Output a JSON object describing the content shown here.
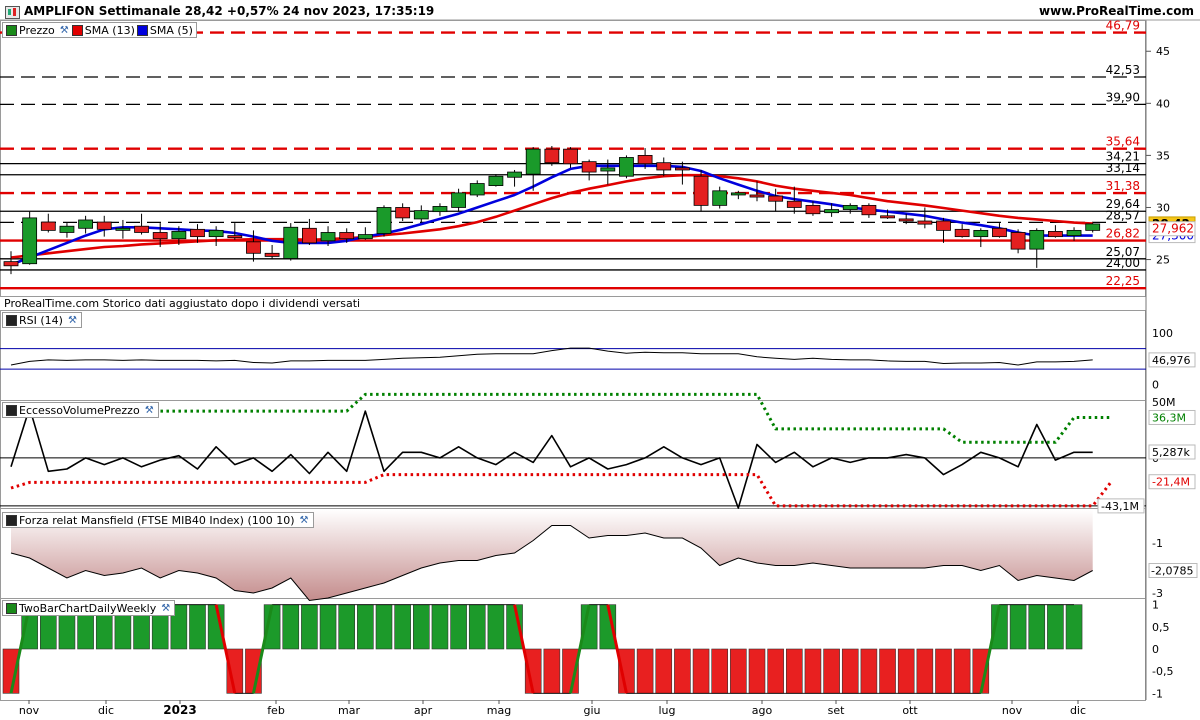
{
  "header": {
    "title": "AMPLIFON Settimanale 28,42 +0,57% 24 nov 2023, 17:35:19",
    "site": "www.ProRealTime.com",
    "source_note": "ProRealTime.com  Storico dati aggiustato dopo i dividendi versati"
  },
  "panels": {
    "price": {
      "legend": [
        {
          "label": "Prezzo",
          "color": "#1a8a1a"
        },
        {
          "label": "SMA (13)",
          "color": "#e00000"
        },
        {
          "label": "SMA (5)",
          "color": "#0000dd"
        }
      ]
    },
    "rsi": {
      "label": "RSI (14)"
    },
    "volume": {
      "label": "EccessoVolumePrezzo"
    },
    "mansfield": {
      "label": "Forza relat Mansfield (FTSE MIB40 Index) (100 10)"
    },
    "twobar": {
      "label": "TwoBarChartDailyWeekly"
    }
  },
  "chart_data": [
    {
      "type": "candlestick",
      "panel": "price",
      "title": "AMPLIFON Settimanale",
      "x_labels": [
        "nov",
        "dic",
        "2023",
        "feb",
        "mar",
        "apr",
        "mag",
        "giu",
        "lug",
        "ago",
        "set",
        "ott",
        "nov",
        "dic"
      ],
      "y_ticks": [
        25,
        30,
        35,
        40,
        45
      ],
      "ylim": [
        21.5,
        48
      ],
      "ohlc": [
        [
          24.8,
          25.8,
          23.6,
          24.4
        ],
        [
          24.6,
          29.6,
          24.5,
          29.0
        ],
        [
          28.6,
          29.4,
          27.6,
          27.8
        ],
        [
          27.6,
          28.5,
          27.1,
          28.2
        ],
        [
          28.0,
          29.2,
          27.5,
          28.8
        ],
        [
          28.6,
          29.2,
          27.2,
          27.9
        ],
        [
          27.8,
          28.8,
          27.0,
          28.0
        ],
        [
          28.2,
          29.4,
          27.4,
          27.6
        ],
        [
          27.6,
          28.5,
          26.2,
          27.0
        ],
        [
          27.0,
          28.2,
          26.4,
          27.7
        ],
        [
          27.9,
          28.4,
          26.6,
          27.2
        ],
        [
          27.2,
          28.2,
          26.3,
          27.8
        ],
        [
          27.3,
          28.5,
          26.9,
          27.1
        ],
        [
          26.7,
          27.8,
          24.8,
          25.6
        ],
        [
          25.6,
          26.4,
          25.0,
          25.3
        ],
        [
          25.1,
          28.5,
          24.9,
          28.1
        ],
        [
          28.0,
          28.9,
          26.4,
          26.6
        ],
        [
          26.8,
          28.2,
          26.3,
          27.6
        ],
        [
          27.6,
          28.0,
          26.6,
          27.0
        ],
        [
          27.0,
          28.1,
          26.9,
          27.4
        ],
        [
          27.5,
          30.2,
          27.2,
          30.0
        ],
        [
          30.0,
          30.4,
          28.7,
          29.0
        ],
        [
          28.9,
          30.2,
          28.6,
          29.7
        ],
        [
          29.6,
          30.4,
          29.2,
          30.1
        ],
        [
          30.0,
          31.8,
          29.6,
          31.4
        ],
        [
          31.2,
          32.6,
          31.0,
          32.3
        ],
        [
          32.1,
          33.2,
          32.0,
          33.0
        ],
        [
          32.9,
          33.6,
          32.0,
          33.4
        ],
        [
          33.2,
          35.8,
          31.6,
          35.6
        ],
        [
          35.6,
          35.9,
          34.0,
          34.3
        ],
        [
          35.6,
          35.8,
          33.8,
          34.2
        ],
        [
          34.4,
          34.6,
          32.6,
          33.4
        ],
        [
          33.5,
          34.6,
          32.2,
          33.8
        ],
        [
          33.0,
          35.0,
          32.8,
          34.8
        ],
        [
          35.0,
          35.7,
          33.7,
          34.2
        ],
        [
          34.3,
          34.8,
          33.0,
          33.6
        ],
        [
          33.8,
          34.4,
          32.2,
          33.6
        ],
        [
          33.0,
          33.6,
          29.6,
          30.2
        ],
        [
          30.2,
          32.0,
          29.9,
          31.6
        ],
        [
          31.2,
          31.6,
          30.8,
          31.4
        ],
        [
          31.2,
          32.5,
          30.6,
          31.0
        ],
        [
          31.1,
          31.8,
          29.6,
          30.6
        ],
        [
          30.6,
          32.0,
          29.4,
          30.0
        ],
        [
          30.2,
          30.6,
          29.2,
          29.4
        ],
        [
          29.5,
          30.4,
          29.1,
          29.8
        ],
        [
          29.8,
          30.4,
          29.4,
          30.2
        ],
        [
          30.2,
          30.4,
          29.0,
          29.3
        ],
        [
          29.2,
          29.8,
          28.9,
          29.0
        ],
        [
          28.9,
          29.4,
          28.4,
          28.7
        ],
        [
          28.7,
          30.0,
          28.0,
          28.4
        ],
        [
          28.7,
          29.0,
          26.6,
          27.8
        ],
        [
          27.9,
          28.4,
          27.1,
          27.2
        ],
        [
          27.2,
          28.0,
          26.2,
          27.8
        ],
        [
          28.0,
          28.5,
          27.1,
          27.2
        ],
        [
          27.6,
          27.9,
          25.6,
          26.0
        ],
        [
          26.0,
          28.0,
          24.2,
          27.8
        ],
        [
          27.7,
          28.3,
          27.1,
          27.2
        ],
        [
          27.3,
          28.1,
          26.8,
          27.8
        ],
        [
          27.8,
          28.5,
          27.6,
          28.42
        ]
      ],
      "series": [
        {
          "name": "SMA (13)",
          "color": "#e00000",
          "values": [
            25.2,
            25.4,
            25.6,
            25.8,
            26.0,
            26.2,
            26.3,
            26.45,
            26.55,
            26.65,
            26.75,
            26.85,
            26.9,
            26.95,
            26.95,
            26.95,
            26.9,
            26.95,
            27.05,
            27.15,
            27.35,
            27.5,
            27.7,
            27.9,
            28.2,
            28.6,
            29.1,
            29.7,
            30.3,
            30.9,
            31.4,
            31.8,
            32.15,
            32.5,
            32.8,
            33.0,
            33.1,
            33.1,
            33.0,
            32.8,
            32.5,
            32.1,
            31.8,
            31.6,
            31.4,
            31.2,
            30.9,
            30.6,
            30.4,
            30.2,
            29.95,
            29.7,
            29.45,
            29.2,
            29.0,
            28.85,
            28.7,
            28.55,
            28.45
          ]
        },
        {
          "name": "SMA (5)",
          "color": "#0000dd",
          "values": [
            24.5,
            25.2,
            25.9,
            26.6,
            27.3,
            27.9,
            28.1,
            28.1,
            28.0,
            27.9,
            27.8,
            27.75,
            27.55,
            27.2,
            26.8,
            26.6,
            26.6,
            26.6,
            26.8,
            27.2,
            27.5,
            27.9,
            28.4,
            28.9,
            29.4,
            30.0,
            30.6,
            31.2,
            32.0,
            32.9,
            33.7,
            34.0,
            34.0,
            34.0,
            34.0,
            34.0,
            33.9,
            33.5,
            32.8,
            32.2,
            31.6,
            31.1,
            30.8,
            30.55,
            30.3,
            30.0,
            29.8,
            29.6,
            29.4,
            29.2,
            28.85,
            28.55,
            28.3,
            28.0,
            27.6,
            27.3,
            27.3,
            27.3,
            27.3
          ]
        }
      ],
      "levels": [
        {
          "value": 46.79,
          "label": "46,79",
          "color": "#e00000",
          "style": "dashed"
        },
        {
          "value": 42.53,
          "label": "42,53",
          "color": "#000000",
          "style": "dashed"
        },
        {
          "value": 39.9,
          "label": "39,90",
          "color": "#000000",
          "style": "dashed"
        },
        {
          "value": 35.64,
          "label": "35,64",
          "color": "#e00000",
          "style": "dashed"
        },
        {
          "value": 34.21,
          "label": "34,21",
          "color": "#000000",
          "style": "solid"
        },
        {
          "value": 33.14,
          "label": "33,14",
          "color": "#000000",
          "style": "solid"
        },
        {
          "value": 31.38,
          "label": "31,38",
          "color": "#e00000",
          "style": "dashed"
        },
        {
          "value": 29.64,
          "label": "29,64",
          "color": "#000000",
          "style": "solid"
        },
        {
          "value": 28.57,
          "label": "28,57",
          "color": "#000000",
          "style": "dashed"
        },
        {
          "value": 26.82,
          "label": "26,82",
          "color": "#e00000",
          "style": "solid"
        },
        {
          "value": 25.07,
          "label": "25,07",
          "color": "#000000",
          "style": "solid"
        },
        {
          "value": 24.0,
          "label": "24,00",
          "color": "#000000",
          "style": "solid"
        },
        {
          "value": 22.25,
          "label": "22,25",
          "color": "#e00000",
          "style": "solid"
        }
      ],
      "last_labels": [
        {
          "value": 28.42,
          "label": "28,42",
          "bg": "#f5c518",
          "color": "#000000"
        },
        {
          "value": 27.3,
          "label": "27,300",
          "bg": "#ffffff",
          "color": "#0000dd"
        },
        {
          "value": 27.96,
          "label": "27,962",
          "bg": "#ffffff",
          "color": "#e00000"
        }
      ]
    },
    {
      "type": "line",
      "panel": "rsi",
      "title": "RSI (14)",
      "ylim": [
        0,
        100
      ],
      "y_ticks": [
        0,
        100
      ],
      "bands": [
        70,
        30
      ],
      "series": [
        {
          "name": "RSI (14)",
          "color": "#000000",
          "values": [
            38,
            45,
            48,
            47,
            48,
            48,
            47,
            48,
            47,
            47,
            47,
            46,
            47,
            43,
            42,
            46,
            46,
            47,
            47,
            47,
            49,
            51,
            52,
            53,
            56,
            59,
            60,
            60,
            60,
            66,
            71,
            71,
            65,
            61,
            63,
            62,
            62,
            60,
            60,
            60,
            54,
            51,
            49,
            51,
            49,
            48,
            48,
            46,
            45,
            45,
            41,
            42,
            42,
            43,
            38,
            44,
            44,
            45,
            48
          ]
        }
      ],
      "last_label": "46,976"
    },
    {
      "type": "line",
      "panel": "volume",
      "title": "EccessoVolumePrezzo",
      "ylim": [
        -45,
        52
      ],
      "tick_labels": [
        "50M",
        "0"
      ],
      "series": [
        {
          "name": "EccessoVolumePrezzo",
          "color": "#000000",
          "values": [
            -8,
            45,
            -12,
            -10,
            0,
            -6,
            0,
            -8,
            -2,
            2,
            -10,
            10,
            -6,
            0,
            -12,
            3,
            -14,
            5,
            -12,
            42,
            -12,
            5,
            5,
            0,
            10,
            0,
            -6,
            5,
            -4,
            20,
            -8,
            0,
            -10,
            -6,
            0,
            10,
            0,
            -6,
            0,
            -45,
            12,
            -4,
            5,
            -8,
            0,
            -4,
            0,
            0,
            3,
            0,
            -15,
            -6,
            5,
            0,
            -8,
            30,
            -2,
            5,
            5
          ]
        },
        {
          "name": "upper",
          "color": "#008000",
          "values": [
            38,
            42,
            42,
            42,
            42,
            42,
            42,
            42,
            42,
            42,
            42,
            42,
            42,
            42,
            42,
            42,
            42,
            42,
            42,
            57,
            57,
            57,
            57,
            57,
            57,
            57,
            57,
            57,
            57,
            57,
            57,
            57,
            57,
            57,
            57,
            57,
            57,
            57,
            57,
            57,
            57,
            26,
            26,
            26,
            26,
            26,
            26,
            26,
            26,
            26,
            26,
            14,
            14,
            14,
            14,
            14,
            14,
            36.3,
            36.3,
            36.3
          ]
        },
        {
          "name": "lower",
          "color": "#e00000",
          "values": [
            -27,
            -22,
            -22,
            -22,
            -22,
            -22,
            -22,
            -22,
            -22,
            -22,
            -22,
            -22,
            -22,
            -22,
            -22,
            -22,
            -22,
            -22,
            -22,
            -22,
            -15,
            -15,
            -15,
            -15,
            -15,
            -15,
            -15,
            -15,
            -15,
            -15,
            -15,
            -15,
            -15,
            -15,
            -15,
            -15,
            -15,
            -15,
            -15,
            -15,
            -15,
            -43.1,
            -43.1,
            -43.1,
            -43.1,
            -43.1,
            -43.1,
            -43.1,
            -43.1,
            -43.1,
            -43.1,
            -43.1,
            -43.1,
            -43.1,
            -43.1,
            -43.1,
            -43.1,
            -43.1,
            -43.1,
            -21.4
          ]
        }
      ],
      "last_labels": [
        {
          "label": "36,3M",
          "color": "#008000",
          "value": 36.3
        },
        {
          "label": "5,287k",
          "color": "#000000",
          "value": 5.3
        },
        {
          "label": "-21,4M",
          "color": "#e00000",
          "value": -21.4
        },
        {
          "label": "-43,1M",
          "color": "#000000",
          "value": -43.1
        }
      ]
    },
    {
      "type": "area",
      "panel": "mansfield",
      "title": "Forza relat Mansfield (FTSE MIB40 Index) (100 10)",
      "ylim": [
        -3.2,
        0.4
      ],
      "y_ticks": [
        -1,
        -2,
        -3
      ],
      "series": [
        {
          "name": "Forza relat Mansfield",
          "color": "#000000",
          "values": [
            -1.4,
            -1.6,
            -2.0,
            -2.4,
            -2.1,
            -2.3,
            -2.2,
            -2.0,
            -2.4,
            -2.1,
            -2.2,
            -2.4,
            -2.9,
            -3.0,
            -2.8,
            -2.4,
            -3.3,
            -3.2,
            -3.0,
            -2.8,
            -2.6,
            -2.3,
            -2.0,
            -1.8,
            -1.7,
            -1.7,
            -1.5,
            -1.4,
            -0.9,
            -0.3,
            -0.3,
            -0.8,
            -0.7,
            -0.7,
            -0.6,
            -0.8,
            -0.8,
            -1.2,
            -1.9,
            -1.6,
            -1.8,
            -1.9,
            -1.9,
            -1.8,
            -1.9,
            -2.0,
            -2.0,
            -2.0,
            -2.0,
            -2.0,
            -1.9,
            -1.9,
            -2.1,
            -1.9,
            -2.5,
            -2.3,
            -2.4,
            -2.5,
            -2.1
          ]
        }
      ],
      "last_label": "-2,0785"
    },
    {
      "type": "bar",
      "panel": "twobar",
      "title": "TwoBarChartDailyWeekly",
      "ylim": [
        -1.15,
        1.15
      ],
      "y_ticks": [
        1,
        0.5,
        0,
        -0.5,
        -1
      ],
      "y_tick_labels": [
        "1",
        "0,5",
        "0",
        "-0,5",
        "-1"
      ],
      "values": [
        -1,
        1,
        1,
        1,
        1,
        1,
        1,
        1,
        1,
        1,
        1,
        1,
        -1,
        -1,
        1,
        1,
        1,
        1,
        1,
        1,
        1,
        1,
        1,
        1,
        1,
        1,
        1,
        1,
        -1,
        -1,
        -1,
        1,
        1,
        -1,
        -1,
        -1,
        -1,
        -1,
        -1,
        -1,
        -1,
        -1,
        -1,
        -1,
        -1,
        -1,
        -1,
        -1,
        -1,
        -1,
        -1,
        -1,
        -1,
        1,
        1,
        1,
        1,
        1
      ]
    }
  ]
}
